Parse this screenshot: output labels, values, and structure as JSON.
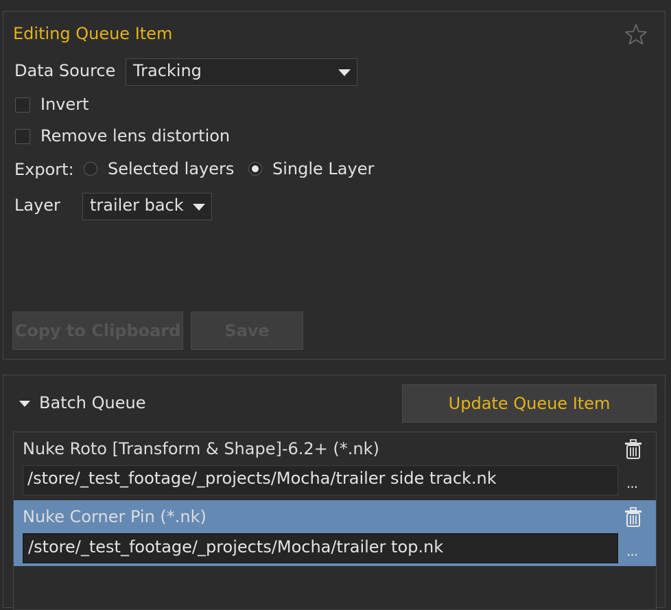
{
  "edit_panel": {
    "title": "Editing Queue Item",
    "data_source": {
      "label": "Data Source",
      "value": "Tracking"
    },
    "invert": {
      "label": "Invert",
      "checked": false
    },
    "remove_lens": {
      "label": "Remove lens distortion",
      "checked": false
    },
    "export": {
      "label": "Export:",
      "options": [
        "Selected layers",
        "Single Layer"
      ],
      "selected": "Single Layer"
    },
    "layer": {
      "label": "Layer",
      "value": "trailer back"
    },
    "copy_label": "Copy to Clipboard",
    "save_label": "Save"
  },
  "batch": {
    "title": "Batch Queue",
    "update_label": "Update Queue Item",
    "items": [
      {
        "name": "Nuke Roto [Transform & Shape]-6.2+ (*.nk)",
        "path": "/store/_test_footage/_projects/Mocha/trailer side track.nk",
        "more": "...",
        "selected": false
      },
      {
        "name": "Nuke Corner Pin (*.nk)",
        "path": "/store/_test_footage/_projects/Mocha/trailer top.nk",
        "more": "...",
        "selected": true
      }
    ]
  },
  "icons": {
    "favorite": "star-icon",
    "delete": "trash-icon",
    "expand": "disclosure-triangle-icon"
  },
  "colors": {
    "accent": "#e3b418",
    "selection": "#6489b3",
    "background": "#2b2b2b"
  }
}
